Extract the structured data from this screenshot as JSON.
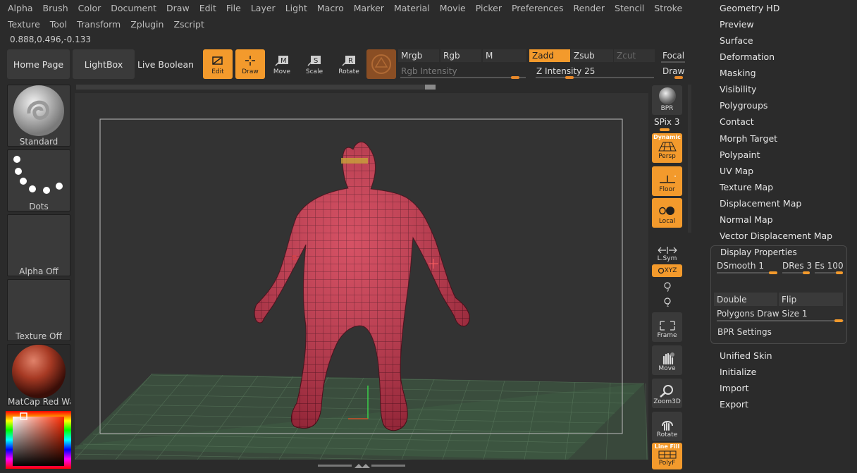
{
  "menu_row1": [
    "Alpha",
    "Brush",
    "Color",
    "Document",
    "Draw",
    "Edit",
    "File",
    "Layer",
    "Light",
    "Macro",
    "Marker",
    "Material",
    "Movie",
    "Picker",
    "Preferences",
    "Render",
    "Stencil",
    "Stroke"
  ],
  "menu_row2": [
    "Texture",
    "Tool",
    "Transform",
    "Zplugin",
    "Zscript"
  ],
  "coords": "0.888,0.496,-0.133",
  "toolbar": {
    "home_page": "Home Page",
    "lightbox": "LightBox",
    "live_boolean": "Live Boolean",
    "edit": "Edit",
    "draw": "Draw",
    "move": "Move",
    "scale": "Scale",
    "rotate": "Rotate",
    "mrgb": "Mrgb",
    "rgb": "Rgb",
    "m": "M",
    "rgb_intensity": "Rgb Intensity",
    "zadd": "Zadd",
    "zsub": "Zsub",
    "zcut": "Zcut",
    "z_intensity_label": "Z Intensity",
    "z_intensity_value": "25",
    "focal": "Focal",
    "draw_size": "Draw",
    "rgb_intensity_level": 0.95,
    "z_intensity_level": 0.25
  },
  "left_panel": {
    "brush": "Standard",
    "stroke": "Dots",
    "alpha": "Alpha Off",
    "texture": "Texture Off",
    "material": "MatCap Red Wax"
  },
  "shelf": {
    "bpr": "BPR",
    "spix_label": "SPix",
    "spix_value": "3",
    "dynamic": "Dynamic",
    "persp": "Persp",
    "floor": "Floor",
    "local": "Local",
    "lsym": "L.Sym",
    "xyz": "XYZ",
    "frame": "Frame",
    "move": "Move",
    "zoom3d": "Zoom3D",
    "rotate": "Rotate",
    "line_fill": "Line Fill",
    "polyf": "PolyF"
  },
  "right_menu": {
    "items_top": [
      "Geometry HD",
      "Preview",
      "Surface",
      "Deformation",
      "Masking",
      "Visibility",
      "Polygroups",
      "Contact",
      "Morph Target",
      "Polypaint",
      "UV Map",
      "Texture Map",
      "Displacement Map",
      "Normal Map",
      "Vector Displacement Map"
    ],
    "display_properties": {
      "title": "Display Properties",
      "dsmooth_label": "DSmooth",
      "dsmooth_value": "1",
      "dres_label": "DRes",
      "dres_value": "3",
      "es_label": "Es",
      "es_value": "100",
      "double": "Double",
      "flip": "Flip",
      "poly_draw_label": "Polygons Draw Size",
      "poly_draw_value": "1",
      "bpr_settings": "BPR Settings"
    },
    "items_bottom": [
      "Unified Skin",
      "Initialize",
      "Import",
      "Export"
    ]
  },
  "colors": {
    "accent": "#f39a2c",
    "model": "#c8384e",
    "grid": "#4d6a4d"
  }
}
